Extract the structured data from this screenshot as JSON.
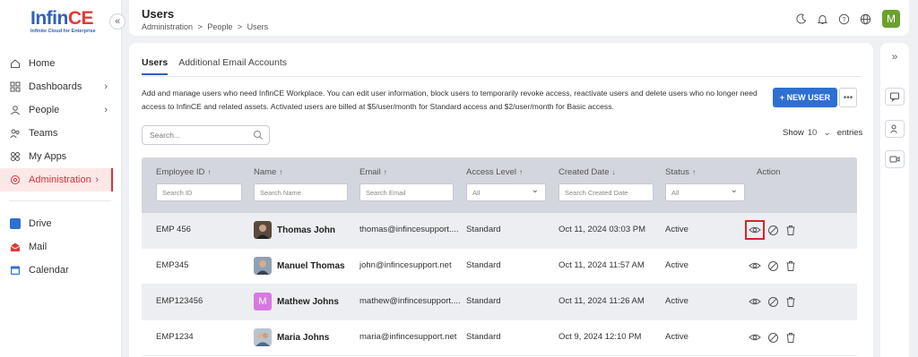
{
  "logo": {
    "brand_a": "Infin",
    "brand_b": "CE",
    "tagline": "Infinite Cloud for Enterprise"
  },
  "sidebar": {
    "items": [
      {
        "label": "Home",
        "icon": "home-icon"
      },
      {
        "label": "Dashboards",
        "icon": "dashboard-icon",
        "has_children": true
      },
      {
        "label": "People",
        "icon": "person-icon",
        "has_children": true
      },
      {
        "label": "Teams",
        "icon": "teams-icon"
      },
      {
        "label": "My Apps",
        "icon": "apps-icon"
      },
      {
        "label": "Administration",
        "icon": "admin-icon",
        "has_children": true,
        "active": true
      }
    ],
    "apps": [
      {
        "label": "Drive",
        "icon": "drive-icon",
        "color": "#2e6fd1"
      },
      {
        "label": "Mail",
        "icon": "mail-icon",
        "color": "#e03a3a"
      },
      {
        "label": "Calendar",
        "icon": "calendar-icon",
        "color": "#2e6fd1"
      }
    ]
  },
  "header": {
    "title": "Users",
    "breadcrumb": [
      "Administration",
      ">",
      "People",
      ">",
      "Users"
    ],
    "avatar_initial": "M",
    "avatar_color": "#6aa22e"
  },
  "tabs": [
    "Users",
    "Additional Email Accounts"
  ],
  "description": "Add and manage users who need InfinCE Workplace. You can edit user information, block users to temporarily revoke access, reactivate users and delete users who no longer need access to InfinCE and related assets. Activated users are billed at  $5/user/month for Standard access and $2/user/month for Basic access.",
  "new_user_label": "+ NEW USER",
  "search_placeholder": "Search...",
  "show_label": "Show",
  "show_value": "10",
  "entries_label": "entries",
  "table": {
    "columns": [
      {
        "label": "Employee ID",
        "sort": "↑",
        "filter": "Search ID"
      },
      {
        "label": "Name",
        "sort": "↑",
        "filter": "Search Name"
      },
      {
        "label": "Email",
        "sort": "↑",
        "filter": "Search Email"
      },
      {
        "label": "Access Level",
        "sort": "↑",
        "filter": "All"
      },
      {
        "label": "Created Date",
        "sort": "↓",
        "filter": "Search Created Date"
      },
      {
        "label": "Status",
        "sort": "↑",
        "filter": "All"
      },
      {
        "label": "Action"
      }
    ],
    "rows": [
      {
        "id": "EMP 456",
        "name": "Thomas John",
        "email": "thomas@infincesupport....",
        "access": "Standard",
        "created": "Oct 11, 2024 03:03 PM",
        "status": "Active"
      },
      {
        "id": "EMP345",
        "name": "Manuel Thomas",
        "email": "john@infincesupport.net",
        "access": "Standard",
        "created": "Oct 11, 2024 11:57 AM",
        "status": "Active"
      },
      {
        "id": "EMP123456",
        "name": "Mathew Johns",
        "email": "mathew@infincesupport....",
        "access": "Standard",
        "created": "Oct 11, 2024 11:26 AM",
        "status": "Active",
        "initial": "M"
      },
      {
        "id": "EMP1234",
        "name": "Maria Johns",
        "email": "maria@infincesupport.net",
        "access": "Standard",
        "created": "Oct 9, 2024 12:10 PM",
        "status": "Active"
      }
    ]
  },
  "colors": {
    "accent": "#2e6fd1",
    "active_nav": "#d8323a",
    "highlight": "#d8232a"
  }
}
